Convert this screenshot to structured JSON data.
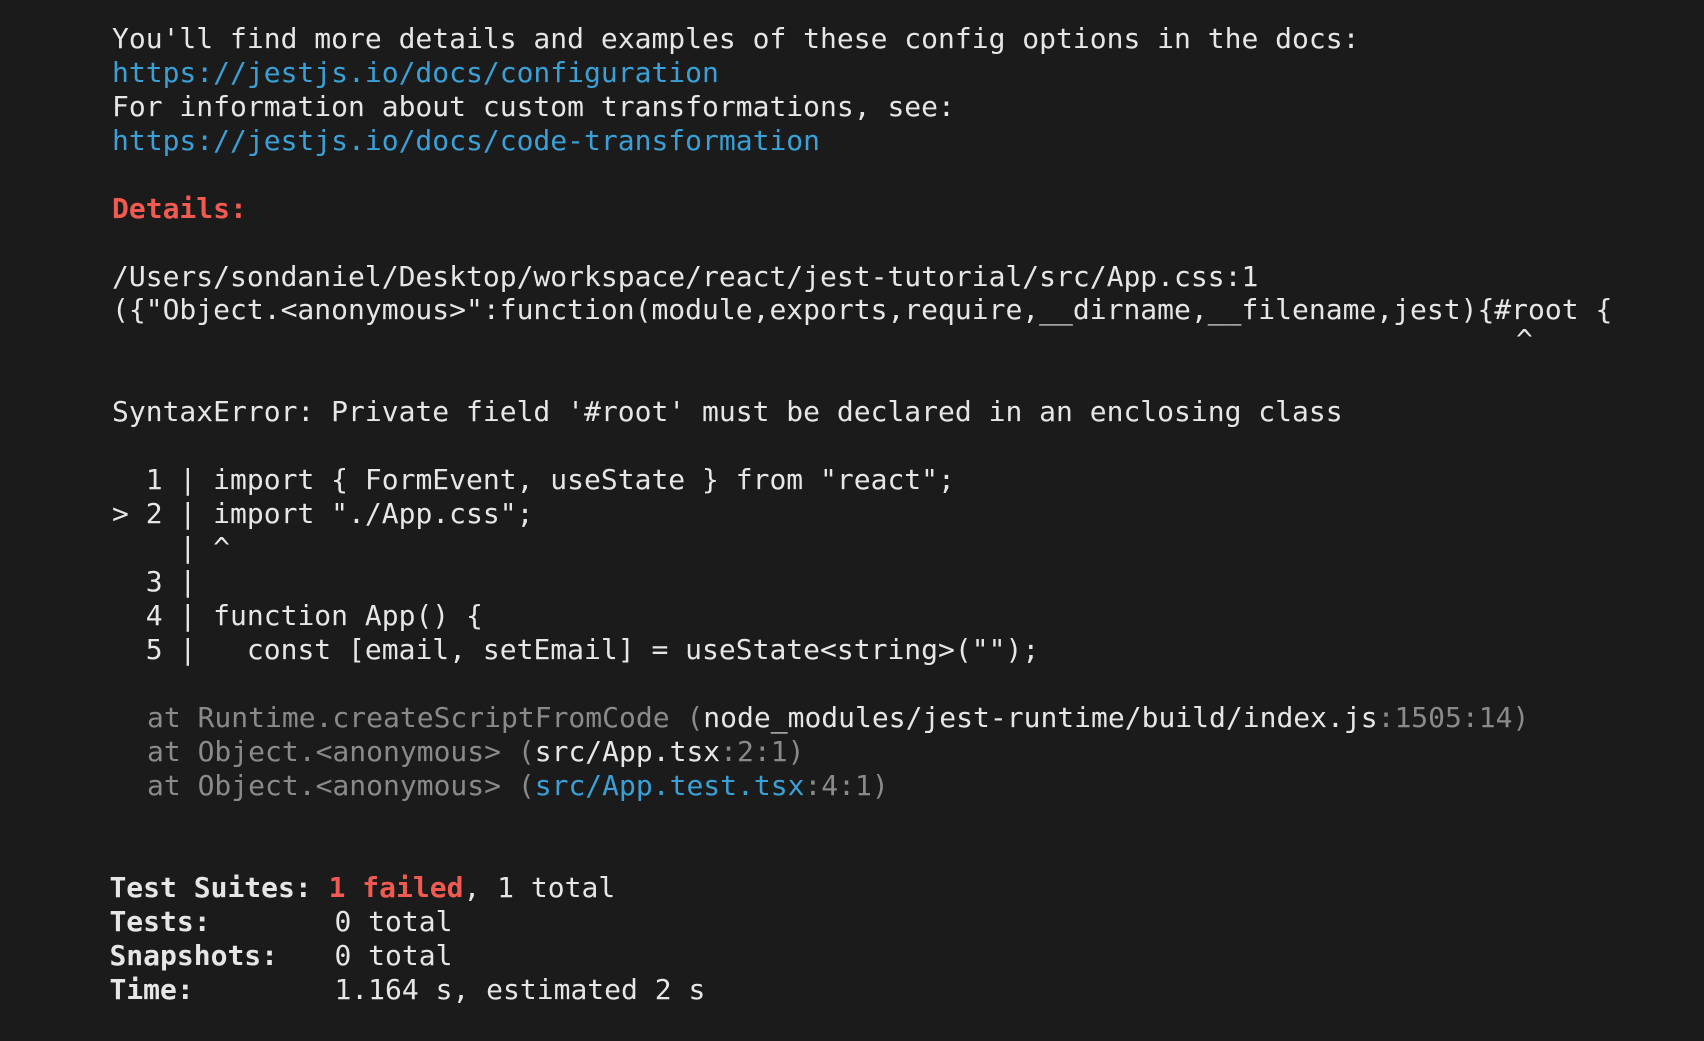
{
  "docs_intro": "You'll find more details and examples of these config options in the docs:",
  "docs_link_config": "https://jestjs.io/docs/configuration",
  "transform_intro": "For information about custom transformations, see:",
  "docs_link_transform": "https://jestjs.io/docs/code-transformation",
  "details_heading": "Details:",
  "file_path": "/Users/sondaniel/Desktop/workspace/react/jest-tutorial/src/App.css:1",
  "wrapper_code": "({\"Object.<anonymous>\":function(module,exports,require,__dirname,__filename,jest){#root {",
  "wrapper_caret": "^",
  "syntax_error": "SyntaxError: Private field '#root' must be declared in an enclosing class",
  "code_frame": [
    {
      "marker": "  ",
      "num": "1",
      "code": "import { FormEvent, useState } from \"react\";"
    },
    {
      "marker": "> ",
      "num": "2",
      "code": "import \"./App.css\";"
    },
    {
      "marker": "  ",
      "num": " ",
      "code": "^"
    },
    {
      "marker": "  ",
      "num": "3",
      "code": ""
    },
    {
      "marker": "  ",
      "num": "4",
      "code": "function App() {"
    },
    {
      "marker": "  ",
      "num": "5",
      "code": "  const [email, setEmail] = useState<string>(\"\");"
    }
  ],
  "stack": [
    {
      "at": "at Runtime.createScriptFromCode (",
      "file": "node_modules/jest-runtime/build/index.js",
      "pos": ":1505:14)",
      "file_link": false
    },
    {
      "at": "at Object.<anonymous> (",
      "file": "src/App.tsx",
      "pos": ":2:1)",
      "file_link": false
    },
    {
      "at": "at Object.<anonymous> (",
      "file": "src/App.test.tsx",
      "pos": ":4:1)",
      "file_link": true
    }
  ],
  "summary": {
    "suites_label": "Test Suites:",
    "suites_failed": "1 failed",
    "suites_rest": ", 1 total",
    "tests_label": "Tests:",
    "tests_value": "0 total",
    "snapshots_label": "Snapshots:",
    "snapshots_value": "0 total",
    "time_label": "Time:",
    "time_value": "1.164 s, estimated 2 s"
  },
  "colors": {
    "background": "#1b1b1b",
    "text": "#e6e6e6",
    "link": "#3aa0d5",
    "error": "#f05a50",
    "dim": "#8a8a8a"
  }
}
